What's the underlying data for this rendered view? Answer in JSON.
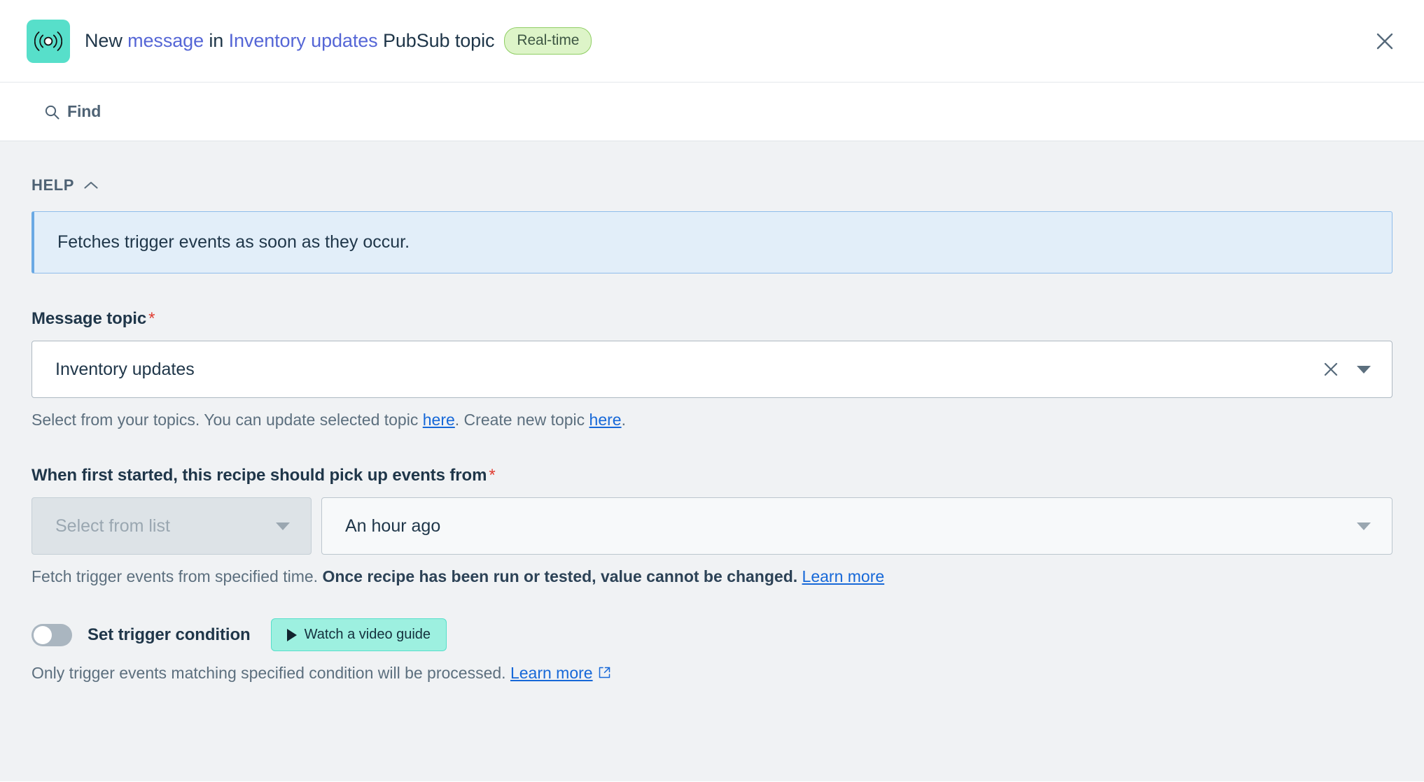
{
  "header": {
    "icon_name": "broadcast-signal-icon",
    "icon_bg": "#57dfca",
    "title_prefix": "New ",
    "title_object": "message",
    "title_mid": " in ",
    "title_topic": "Inventory updates",
    "title_suffix": " PubSub topic",
    "badge": "Real-time",
    "badge_bg": "#ddf4c8",
    "badge_border": "#8fce63",
    "close_label": "Close"
  },
  "findbar": {
    "label": "Find",
    "icon": "search-icon"
  },
  "help_section": {
    "title": "HELP",
    "chevron": "chevron-up-icon",
    "info_text": "Fetches trigger events as soon as they occur.",
    "info_bg": "#e2eef9",
    "info_border": "#8fbdeb"
  },
  "message_topic": {
    "label": "Message topic",
    "required_marker": "*",
    "value": "Inventory updates",
    "clear_icon": "close-icon",
    "dropdown_icon": "caret-down-icon",
    "hint_part1": "Select from your topics. You can update selected topic ",
    "hint_link1": "here",
    "hint_part2": ". Create new topic ",
    "hint_link2": "here",
    "hint_part3": "."
  },
  "pick_up_events": {
    "label": "When first started, this recipe should pick up events from",
    "required_marker": "*",
    "left_select_placeholder": "Select from list",
    "left_select_disabled": true,
    "right_select_value": "An hour ago",
    "hint_part1": "Fetch trigger events from specified time. ",
    "hint_bold": "Once recipe has been run or tested, value cannot be changed.",
    "hint_part2": " ",
    "hint_link": "Learn more"
  },
  "trigger_condition": {
    "toggle_state": "off",
    "label": "Set trigger condition",
    "video_button_label": "Watch a video guide",
    "video_button_bg": "#9df0e0",
    "hint_text": "Only trigger events matching specified condition will be processed. ",
    "hint_link": "Learn more",
    "external_icon": "external-link-icon"
  }
}
